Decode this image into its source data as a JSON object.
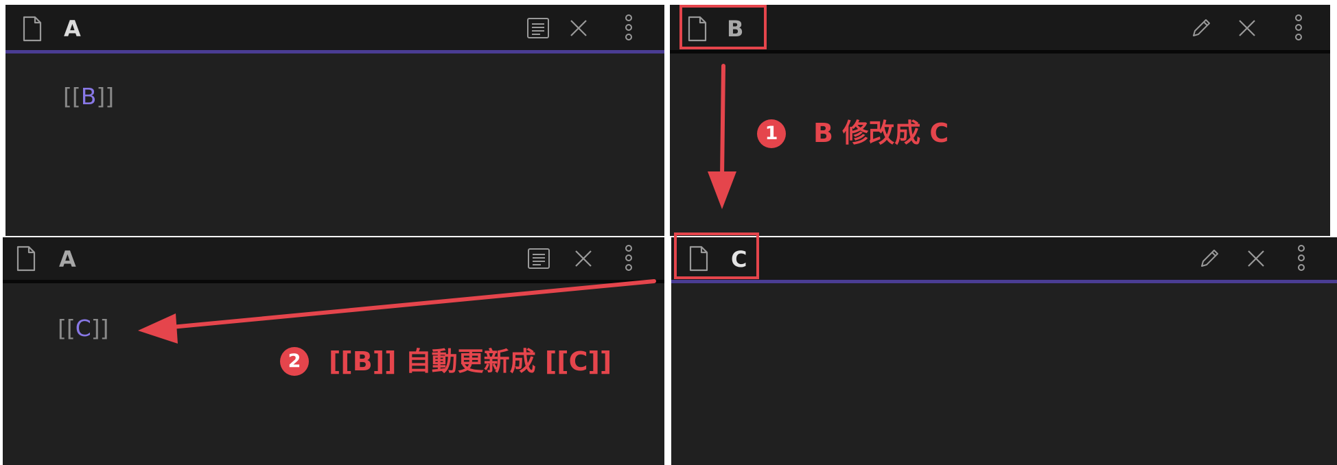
{
  "panes": {
    "top_left": {
      "title": "A",
      "link_open": "[[",
      "link_text": "B",
      "link_close": "]]"
    },
    "top_right": {
      "title": "B"
    },
    "bottom_left": {
      "title": "A",
      "link_open": "[[",
      "link_text": "C",
      "link_close": "]]"
    },
    "bottom_right": {
      "title": "C"
    }
  },
  "annotations": {
    "step1": {
      "number": "1",
      "text": "B 修改成 C"
    },
    "step2": {
      "number": "2",
      "text": "[[B]] 自動更新成 [[C]]"
    }
  },
  "icons": [
    "file-icon",
    "reading-view-icon",
    "edit-pencil-icon",
    "close-icon",
    "more-options-icon"
  ],
  "colors": {
    "accent": "#4a3d93",
    "link": "#8878e6",
    "annotation": "#e5454c",
    "background": "#202020"
  }
}
